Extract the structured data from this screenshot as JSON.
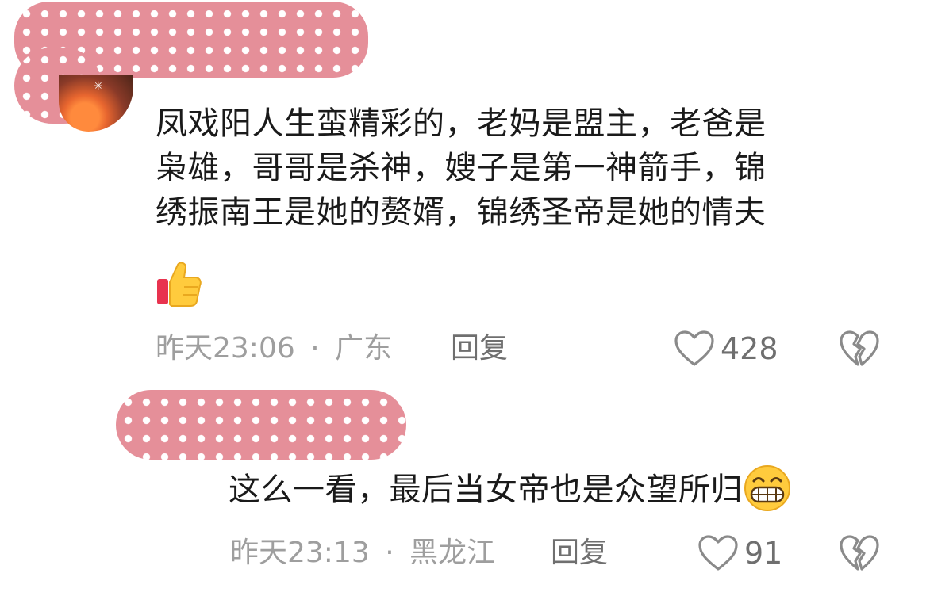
{
  "comments": [
    {
      "text_lines": [
        "凤戏阳人生蛮精彩的，老妈是盟主，老爸是",
        "枭雄，哥哥是杀神，嫂子是第一神箭手，锦",
        "绣振南王是她的赘婿，锦绣圣帝是她的情夫"
      ],
      "emoji": "thumbs-up",
      "time": "昨天23:06",
      "separator": "·",
      "location": "广东",
      "reply_label": "回复",
      "likes": "428"
    },
    {
      "text": "这么一看，最后当女帝也是众望所归",
      "emoji": "grinning-face",
      "time": "昨天23:13",
      "separator": "·",
      "location": "黑龙江",
      "reply_label": "回复",
      "likes": "91"
    }
  ],
  "icons": {
    "like": "heart-outline-icon",
    "dislike": "broken-heart-icon"
  },
  "colors": {
    "censor": "#e58f99",
    "text": "#1a1a1a",
    "meta": "#9e9e9e",
    "action": "#6f6f6f"
  }
}
